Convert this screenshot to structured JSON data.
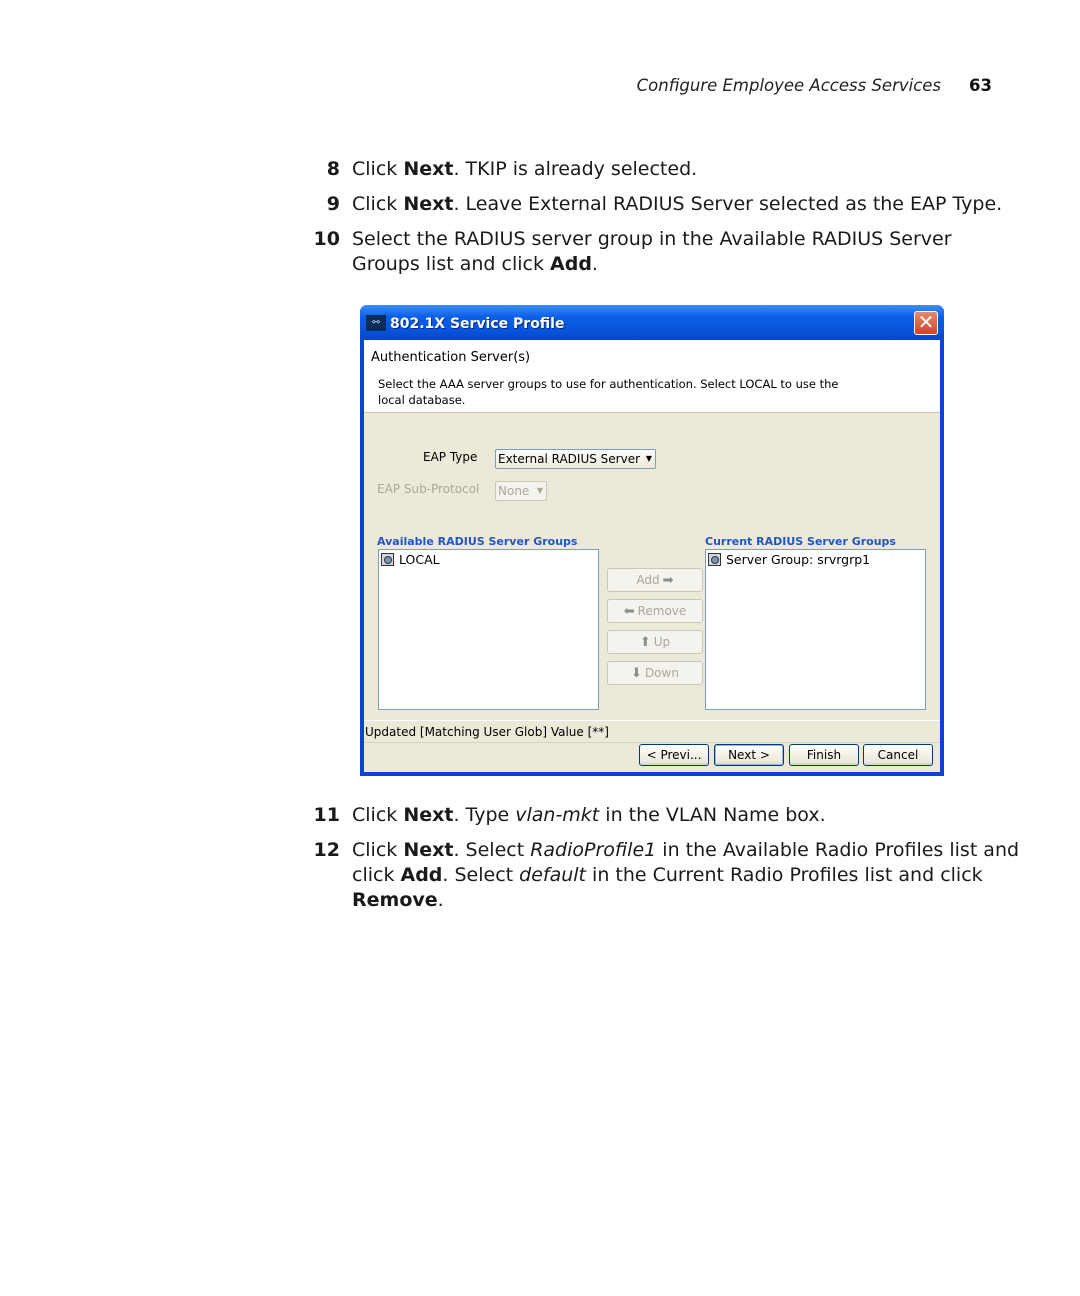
{
  "header": {
    "section": "Configure Employee Access Services",
    "page_number": "63"
  },
  "steps_before": [
    {
      "num": "8",
      "parts": [
        [
          "t",
          "Click "
        ],
        [
          "b",
          "Next"
        ],
        [
          "t",
          ". TKIP is already selected."
        ]
      ]
    },
    {
      "num": "9",
      "parts": [
        [
          "t",
          "Click "
        ],
        [
          "b",
          "Next"
        ],
        [
          "t",
          ". Leave External RADIUS Server selected as the EAP Type."
        ]
      ]
    },
    {
      "num": "10",
      "parts": [
        [
          "t",
          "Select the RADIUS server group in the Available RADIUS Server Groups list and click "
        ],
        [
          "b",
          "Add"
        ],
        [
          "t",
          "."
        ]
      ]
    }
  ],
  "steps_after": [
    {
      "num": "11",
      "parts": [
        [
          "t",
          "Click "
        ],
        [
          "b",
          "Next"
        ],
        [
          "t",
          ". Type "
        ],
        [
          "i",
          "vlan-mkt"
        ],
        [
          "t",
          " in the VLAN Name box."
        ]
      ]
    },
    {
      "num": "12",
      "parts": [
        [
          "t",
          "Click "
        ],
        [
          "b",
          "Next"
        ],
        [
          "t",
          ". Select "
        ],
        [
          "i",
          "RadioProfile1"
        ],
        [
          "t",
          " in the Available Radio Profiles list and click "
        ],
        [
          "b",
          "Add"
        ],
        [
          "t",
          ". Select "
        ],
        [
          "i",
          "default"
        ],
        [
          "t",
          " in the Current Radio Profiles list and click "
        ],
        [
          "b",
          "Remove"
        ],
        [
          "t",
          "."
        ]
      ]
    }
  ],
  "dialog": {
    "title": "802.1X Service Profile",
    "app_icon": "network-icon",
    "close_icon": "close-icon",
    "banner_title": "Authentication Server(s)",
    "banner_desc": "Select the AAA server groups to use for authentication. Select LOCAL to use the local database.",
    "eap_type_label": "EAP Type",
    "eap_type_value": "External RADIUS Server",
    "eap_sub_label": "EAP Sub-Protocol",
    "eap_sub_value": "None",
    "available_label": "Available RADIUS Server Groups",
    "available_items": [
      "LOCAL"
    ],
    "current_label": "Current RADIUS Server Groups",
    "current_items": [
      "Server Group: srvrgrp1"
    ],
    "buttons_mid": {
      "add": "Add",
      "remove": "Remove",
      "up": "Up",
      "down": "Down"
    },
    "status_text": "Updated [Matching User Glob] Value [**]",
    "buttons": {
      "previous": "< Previ...",
      "next": "Next >",
      "finish": "Finish",
      "cancel": "Cancel"
    },
    "colors": {
      "title_bar": "#0a5ee8",
      "group_label": "#2155c7",
      "client_bg": "#ece9d8"
    }
  }
}
